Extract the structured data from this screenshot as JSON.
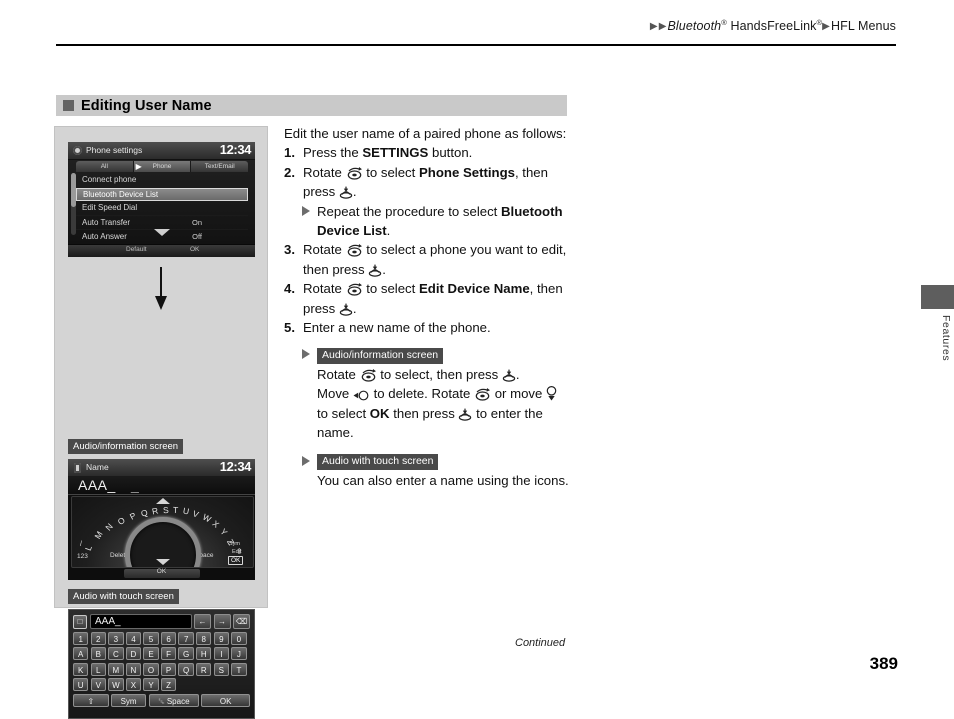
{
  "header": {
    "breadcrumb_arrow": "▶",
    "crumb1": "Bluetooth",
    "crumb1_sup": "®",
    "crumb2": "HandsFreeLink",
    "crumb2_sup": "®",
    "crumb3": "HFL Menus"
  },
  "section": {
    "title": "Editing User Name"
  },
  "figure": {
    "screen1": {
      "title": "Phone settings",
      "clock": "12:34",
      "tabs": [
        "All",
        "Phone",
        "Text/Email"
      ],
      "selected_tab": "Phone",
      "rows": [
        {
          "label": "Connect phone",
          "value": "",
          "highlighted": false
        },
        {
          "label": "Bluetooth Device List",
          "value": "",
          "highlighted": true
        },
        {
          "label": "Edit Speed Dial",
          "value": "",
          "highlighted": false
        },
        {
          "label": "Auto Transfer",
          "value": "On",
          "highlighted": false
        },
        {
          "label": "Auto Answer",
          "value": "Off",
          "highlighted": false
        }
      ],
      "bottom_left": "Default",
      "bottom_right": "OK"
    },
    "caption_audio_info": "Audio/information screen",
    "caption_audio_touch": "Audio with touch screen",
    "screen2": {
      "title": "Name",
      "clock": "12:34",
      "entered_text": "AAA_",
      "cursor_mark": "_",
      "arc_letters": [
        "L",
        "M",
        "N",
        "O",
        "P",
        "Q",
        "R",
        "S",
        "T",
        "U",
        "V",
        "W",
        "X",
        "Y",
        "Z"
      ],
      "label_123": "123",
      "label_delete": "Delete",
      "label_space": "Space",
      "label_sym": "Sym",
      "label_edit": "Edit",
      "label_ok_box": "OK",
      "label_ok_bar": "OK"
    },
    "screen3": {
      "input_value": "AAA_",
      "input_icon": "keyboard-lang-icon",
      "top_buttons": [
        "←",
        "→",
        "⌫"
      ],
      "row_numbers": [
        "1",
        "2",
        "3",
        "4",
        "5",
        "6",
        "7",
        "8",
        "9",
        "0"
      ],
      "row_letters1": [
        "A",
        "B",
        "C",
        "D",
        "E",
        "F",
        "G",
        "H",
        "I",
        "J"
      ],
      "row_letters2": [
        "K",
        "L",
        "M",
        "N",
        "O",
        "P",
        "Q",
        "R",
        "S",
        "T"
      ],
      "row_letters3": [
        "U",
        "V",
        "W",
        "X",
        "Y",
        "Z"
      ],
      "shift_label": "⇧",
      "sym_label": "Sym",
      "space_label": "Space",
      "ok_label": "OK"
    }
  },
  "body": {
    "intro": "Edit the user name of a paired phone as follows:",
    "step1": {
      "num": "1.",
      "pre": "Press the ",
      "bold": "SETTINGS",
      "post": " button."
    },
    "step2": {
      "num": "2.",
      "pre": "Rotate ",
      "mid": " to select ",
      "bold": "Phone Settings",
      "post": ", then press ",
      "tail": ".",
      "sub_pre": "Repeat the procedure to select ",
      "sub_bold": "Bluetooth Device List",
      "sub_post": "."
    },
    "step3": {
      "num": "3.",
      "pre": "Rotate ",
      "mid": " to select a phone you want to edit, then press ",
      "tail": "."
    },
    "step4": {
      "num": "4.",
      "pre": "Rotate ",
      "mid": " to select ",
      "bold": "Edit Device Name",
      "post": ", then press ",
      "tail": "."
    },
    "step5": {
      "num": "5.",
      "text": "Enter a new name of the phone."
    },
    "note1": {
      "caption": "Audio/information screen",
      "l1_pre": "Rotate ",
      "l1_mid": " to select, then press ",
      "l1_end": ".",
      "l2_pre": "Move ",
      "l2_mid": " to delete. Rotate ",
      "l2_mid2": " or move ",
      "l3_pre": "to select ",
      "l3_bold": "OK",
      "l3_mid": " then press ",
      "l3_end": " to enter the name."
    },
    "note2": {
      "caption": "Audio with touch screen",
      "text": "You can also enter a name using the icons."
    }
  },
  "side_tab": {
    "label": "Features"
  },
  "footer": {
    "continued": "Continued",
    "page": "389"
  }
}
